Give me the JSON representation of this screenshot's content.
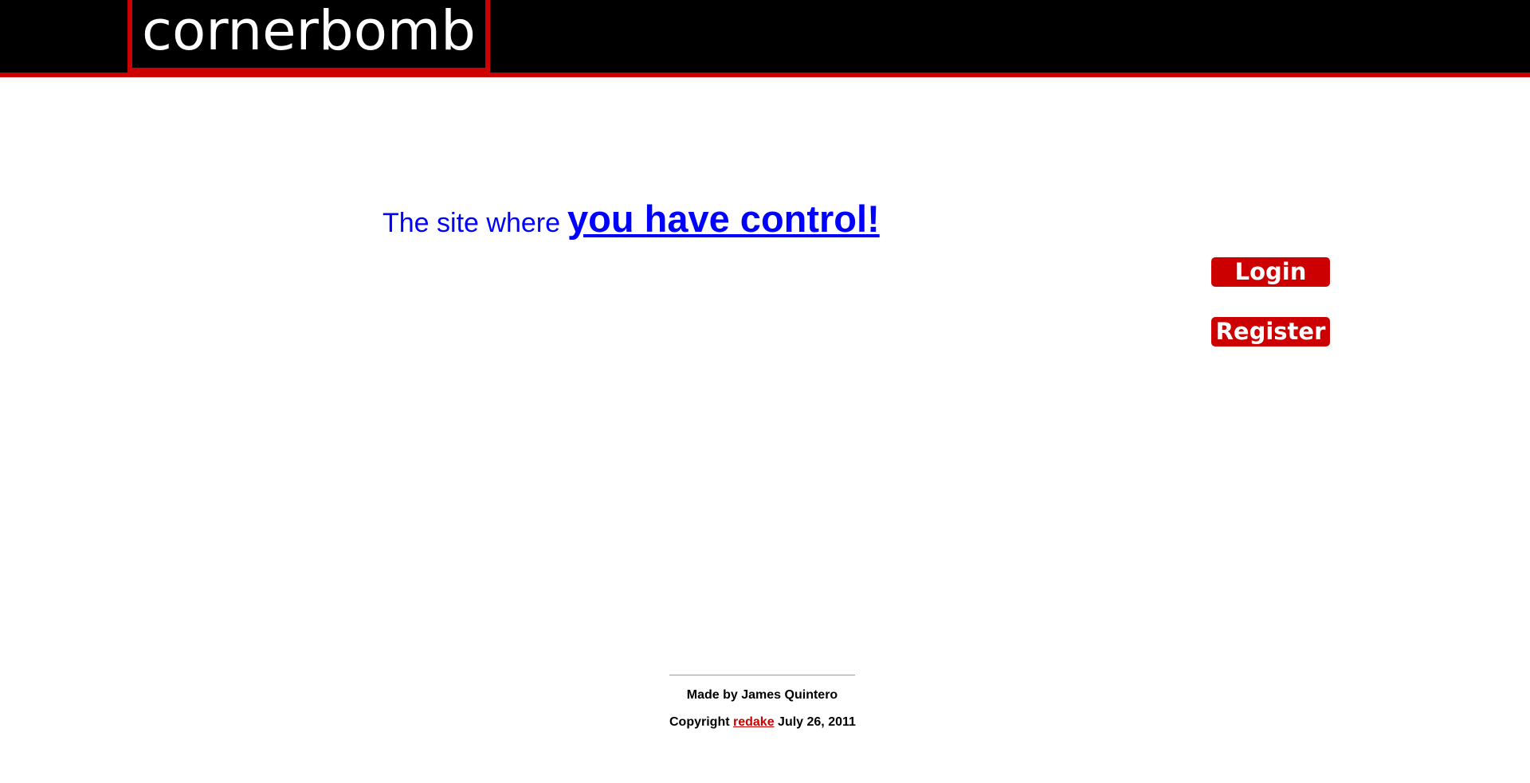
{
  "header": {
    "logo_text": "cornerbomb"
  },
  "main": {
    "tagline_lead": "The site where",
    "tagline_link": "you have control!"
  },
  "auth": {
    "login_label": "Login",
    "register_label": "Register"
  },
  "footer": {
    "made_by": "Made by James Quintero",
    "copyright_prefix": "Copyright",
    "copyright_link": "redake",
    "copyright_date": "July 26, 2011"
  },
  "colors": {
    "header_background": "#000000",
    "accent_red": "#cc0000",
    "tagline_blue": "#0000ff",
    "page_background": "#ffffff"
  }
}
